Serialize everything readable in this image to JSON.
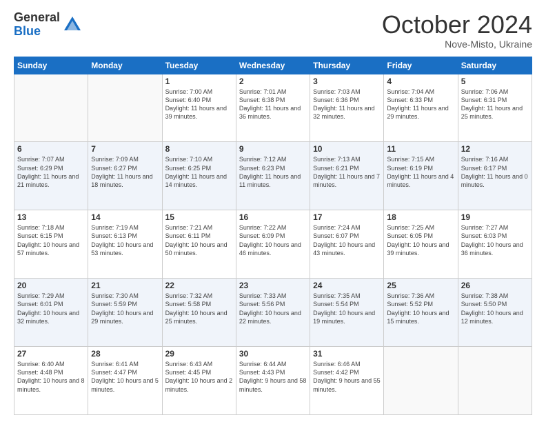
{
  "header": {
    "logo_general": "General",
    "logo_blue": "Blue",
    "month_title": "October 2024",
    "subtitle": "Nove-Misto, Ukraine"
  },
  "days_of_week": [
    "Sunday",
    "Monday",
    "Tuesday",
    "Wednesday",
    "Thursday",
    "Friday",
    "Saturday"
  ],
  "weeks": [
    [
      {
        "day": "",
        "info": ""
      },
      {
        "day": "",
        "info": ""
      },
      {
        "day": "1",
        "info": "Sunrise: 7:00 AM\nSunset: 6:40 PM\nDaylight: 11 hours and 39 minutes."
      },
      {
        "day": "2",
        "info": "Sunrise: 7:01 AM\nSunset: 6:38 PM\nDaylight: 11 hours and 36 minutes."
      },
      {
        "day": "3",
        "info": "Sunrise: 7:03 AM\nSunset: 6:36 PM\nDaylight: 11 hours and 32 minutes."
      },
      {
        "day": "4",
        "info": "Sunrise: 7:04 AM\nSunset: 6:33 PM\nDaylight: 11 hours and 29 minutes."
      },
      {
        "day": "5",
        "info": "Sunrise: 7:06 AM\nSunset: 6:31 PM\nDaylight: 11 hours and 25 minutes."
      }
    ],
    [
      {
        "day": "6",
        "info": "Sunrise: 7:07 AM\nSunset: 6:29 PM\nDaylight: 11 hours and 21 minutes."
      },
      {
        "day": "7",
        "info": "Sunrise: 7:09 AM\nSunset: 6:27 PM\nDaylight: 11 hours and 18 minutes."
      },
      {
        "day": "8",
        "info": "Sunrise: 7:10 AM\nSunset: 6:25 PM\nDaylight: 11 hours and 14 minutes."
      },
      {
        "day": "9",
        "info": "Sunrise: 7:12 AM\nSunset: 6:23 PM\nDaylight: 11 hours and 11 minutes."
      },
      {
        "day": "10",
        "info": "Sunrise: 7:13 AM\nSunset: 6:21 PM\nDaylight: 11 hours and 7 minutes."
      },
      {
        "day": "11",
        "info": "Sunrise: 7:15 AM\nSunset: 6:19 PM\nDaylight: 11 hours and 4 minutes."
      },
      {
        "day": "12",
        "info": "Sunrise: 7:16 AM\nSunset: 6:17 PM\nDaylight: 11 hours and 0 minutes."
      }
    ],
    [
      {
        "day": "13",
        "info": "Sunrise: 7:18 AM\nSunset: 6:15 PM\nDaylight: 10 hours and 57 minutes."
      },
      {
        "day": "14",
        "info": "Sunrise: 7:19 AM\nSunset: 6:13 PM\nDaylight: 10 hours and 53 minutes."
      },
      {
        "day": "15",
        "info": "Sunrise: 7:21 AM\nSunset: 6:11 PM\nDaylight: 10 hours and 50 minutes."
      },
      {
        "day": "16",
        "info": "Sunrise: 7:22 AM\nSunset: 6:09 PM\nDaylight: 10 hours and 46 minutes."
      },
      {
        "day": "17",
        "info": "Sunrise: 7:24 AM\nSunset: 6:07 PM\nDaylight: 10 hours and 43 minutes."
      },
      {
        "day": "18",
        "info": "Sunrise: 7:25 AM\nSunset: 6:05 PM\nDaylight: 10 hours and 39 minutes."
      },
      {
        "day": "19",
        "info": "Sunrise: 7:27 AM\nSunset: 6:03 PM\nDaylight: 10 hours and 36 minutes."
      }
    ],
    [
      {
        "day": "20",
        "info": "Sunrise: 7:29 AM\nSunset: 6:01 PM\nDaylight: 10 hours and 32 minutes."
      },
      {
        "day": "21",
        "info": "Sunrise: 7:30 AM\nSunset: 5:59 PM\nDaylight: 10 hours and 29 minutes."
      },
      {
        "day": "22",
        "info": "Sunrise: 7:32 AM\nSunset: 5:58 PM\nDaylight: 10 hours and 25 minutes."
      },
      {
        "day": "23",
        "info": "Sunrise: 7:33 AM\nSunset: 5:56 PM\nDaylight: 10 hours and 22 minutes."
      },
      {
        "day": "24",
        "info": "Sunrise: 7:35 AM\nSunset: 5:54 PM\nDaylight: 10 hours and 19 minutes."
      },
      {
        "day": "25",
        "info": "Sunrise: 7:36 AM\nSunset: 5:52 PM\nDaylight: 10 hours and 15 minutes."
      },
      {
        "day": "26",
        "info": "Sunrise: 7:38 AM\nSunset: 5:50 PM\nDaylight: 10 hours and 12 minutes."
      }
    ],
    [
      {
        "day": "27",
        "info": "Sunrise: 6:40 AM\nSunset: 4:48 PM\nDaylight: 10 hours and 8 minutes."
      },
      {
        "day": "28",
        "info": "Sunrise: 6:41 AM\nSunset: 4:47 PM\nDaylight: 10 hours and 5 minutes."
      },
      {
        "day": "29",
        "info": "Sunrise: 6:43 AM\nSunset: 4:45 PM\nDaylight: 10 hours and 2 minutes."
      },
      {
        "day": "30",
        "info": "Sunrise: 6:44 AM\nSunset: 4:43 PM\nDaylight: 9 hours and 58 minutes."
      },
      {
        "day": "31",
        "info": "Sunrise: 6:46 AM\nSunset: 4:42 PM\nDaylight: 9 hours and 55 minutes."
      },
      {
        "day": "",
        "info": ""
      },
      {
        "day": "",
        "info": ""
      }
    ]
  ]
}
